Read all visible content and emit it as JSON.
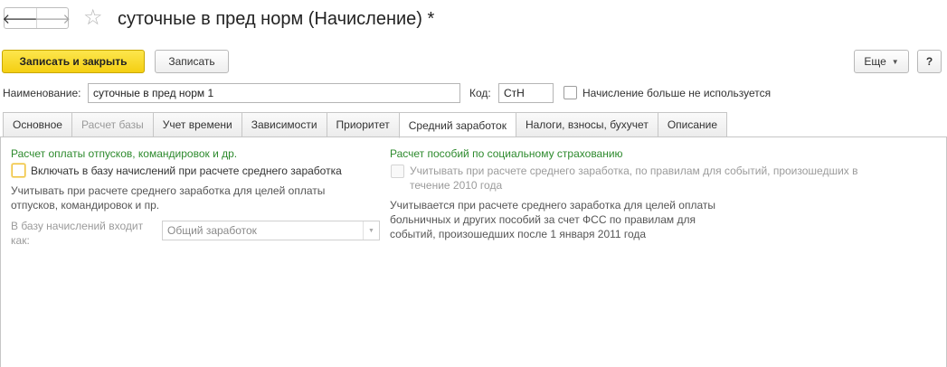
{
  "header": {
    "back_icon": "arrow-left-icon",
    "forward_icon": "arrow-right-icon",
    "star_icon": "star-icon",
    "back_glyph": "🡐",
    "forward_glyph": "🡒",
    "star_glyph": "☆",
    "title": "суточные в пред норм (Начисление) *"
  },
  "toolbar": {
    "save_close_label": "Записать и закрыть",
    "save_label": "Записать",
    "more_label": "Еще",
    "more_caret": "▼",
    "help_label": "?"
  },
  "form": {
    "name_label": "Наименование:",
    "name_value": "суточные в пред норм 1",
    "code_label": "Код:",
    "code_value": "СтН",
    "unused_label": "Начисление больше не используется",
    "unused_checked": false
  },
  "tabs": [
    {
      "label": "Основное",
      "state": "normal"
    },
    {
      "label": "Расчет базы",
      "state": "disabled"
    },
    {
      "label": "Учет времени",
      "state": "normal"
    },
    {
      "label": "Зависимости",
      "state": "normal"
    },
    {
      "label": "Приоритет",
      "state": "normal"
    },
    {
      "label": "Средний заработок",
      "state": "active"
    },
    {
      "label": "Налоги, взносы, бухучет",
      "state": "normal"
    },
    {
      "label": "Описание",
      "state": "normal"
    }
  ],
  "left_section": {
    "title": "Расчет оплаты отпусков, командировок и др.",
    "include_checkbox_label": "Включать в базу начислений при расчете среднего заработка",
    "include_checked": false,
    "description_line1": "Учитывать при расчете среднего заработка для целей оплаты",
    "description_line2": "отпусков, командировок и пр.",
    "base_label_line1": "В базу начислений входит",
    "base_label_line2": "как:",
    "base_value": "Общий заработок",
    "base_arrow": "▼"
  },
  "right_section": {
    "title": "Расчет пособий по социальному страхованию",
    "checkbox_label_line1": "Учитывать при расчете среднего заработка, по правилам для событий, произошедших в",
    "checkbox_label_line2": "течение 2010 года",
    "checkbox_checked": false,
    "description_line1": "Учитывается при расчете среднего заработка для целей оплаты",
    "description_line2": "больничных и других пособий за счет ФСС по правилам для",
    "description_line3": "событий, произошедших после 1 января 2011 года"
  },
  "colors": {
    "primary_button": "#f4cf12",
    "section_title": "#2d8a2d",
    "disabled_text": "#9b9b9b"
  }
}
